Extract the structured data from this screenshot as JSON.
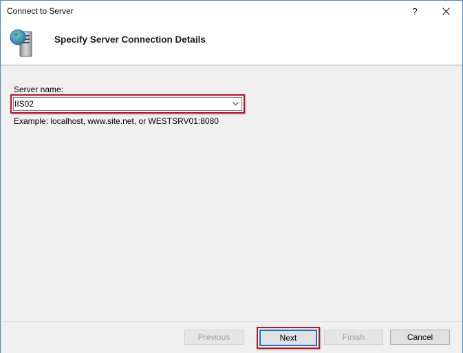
{
  "window": {
    "title": "Connect to Server",
    "help_glyph": "?"
  },
  "header": {
    "title": "Specify Server Connection Details",
    "icon": "server-globe-icon"
  },
  "form": {
    "server_name_label": "Server name:",
    "server_name_value": "IIS02",
    "example_text": "Example: localhost, www.site.net, or WESTSRV01:8080"
  },
  "buttons": {
    "previous": "Previous",
    "next": "Next",
    "finish": "Finish",
    "cancel": "Cancel"
  },
  "colors": {
    "highlight": "#c0121f",
    "focus": "#0078d7",
    "window_border": "#4a88c7"
  }
}
